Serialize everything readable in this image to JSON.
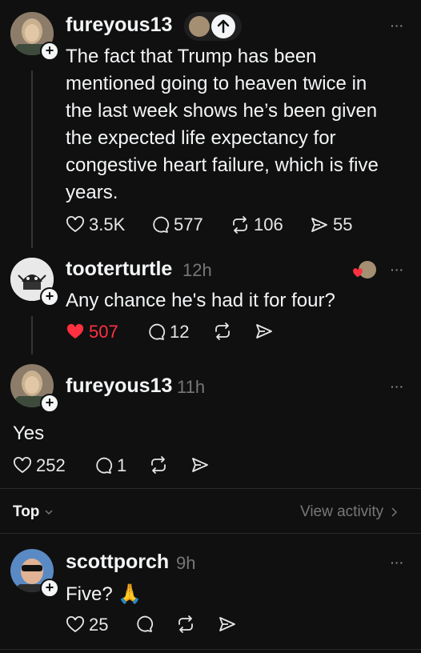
{
  "posts": [
    {
      "username": "fureyous13",
      "text_lines": [
        "The fact that Trump has been",
        "mentioned going to heaven twice in",
        "the last week shows he’s been given",
        "the expected life expectancy for",
        "congestive heart failure, which is five",
        "years."
      ],
      "likes": "3.5K",
      "replies": "577",
      "reposts": "106",
      "shares": "55"
    },
    {
      "username": "tooterturtle",
      "time": "12h",
      "text": "Any chance he's had it for four?",
      "likes": "507",
      "replies": "12"
    },
    {
      "username": "fureyous13",
      "time": "11h",
      "text": "Yes",
      "likes": "252",
      "replies": "1"
    },
    {
      "username": "scottporch",
      "time": "9h",
      "text": "Five? 🙏",
      "likes": "25"
    }
  ],
  "sort": {
    "label": "Top",
    "view_activity": "View activity"
  },
  "colors": {
    "background": "#101010",
    "liked": "#ff3040",
    "muted": "#777777"
  },
  "more_icon": "···"
}
